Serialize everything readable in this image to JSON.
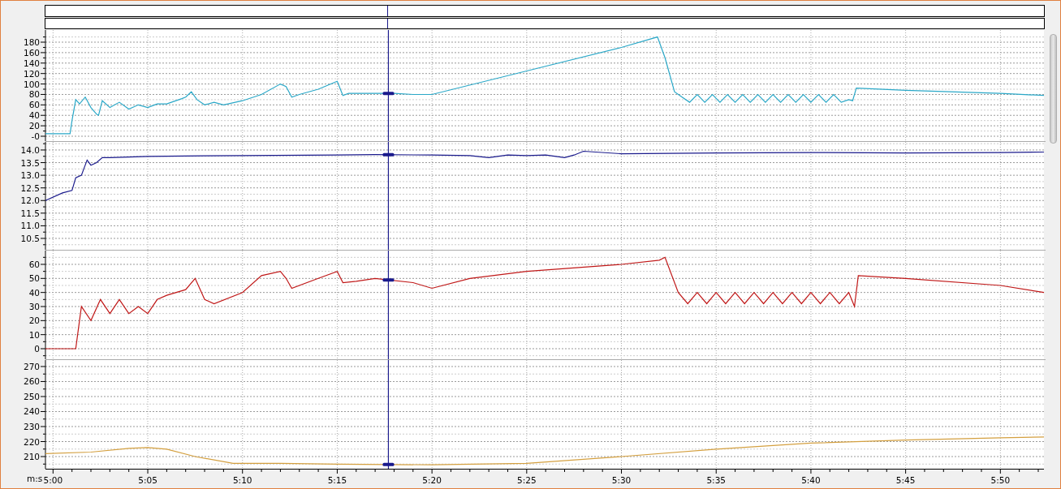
{
  "charts": [
    {
      "chart_data": {
        "type": "line",
        "xlim": [
          299.6,
          352.3
        ],
        "ylim": [
          -9.3,
          203.3
        ],
        "yticks": [
          {
            "value": 0,
            "label": "-0"
          },
          20,
          40,
          60,
          80,
          100,
          120,
          140,
          160,
          180
        ],
        "x": [
          299.6,
          300.4,
          300.9,
          301.0,
          301.2,
          301.4,
          301.7,
          302.0,
          302.3,
          302.4,
          302.6,
          303.0,
          303.5,
          304.0,
          304.5,
          305.0,
          305.5,
          306.0,
          306.8,
          307.0,
          307.3,
          307.6,
          308.0,
          308.5,
          309.0,
          310,
          311,
          312.0,
          312.3,
          312.6,
          313,
          314,
          315.0,
          315.3,
          315.6,
          316,
          317,
          318,
          319,
          320,
          325,
          330,
          331.9,
          332.3,
          332.8,
          333.2,
          333.6,
          334,
          334.4,
          334.8,
          335.2,
          335.6,
          336,
          336.4,
          336.8,
          337.2,
          337.6,
          338,
          338.4,
          338.8,
          339.2,
          339.6,
          340,
          340.4,
          340.8,
          341.2,
          341.6,
          342.0,
          342.2,
          342.4,
          345,
          350,
          352.3
        ],
        "series": [
          {
            "color": "#2aa8c8",
            "values": [
              5,
              5,
              5,
              30,
              70,
              62,
              75,
              55,
              42,
              40,
              68,
              55,
              65,
              52,
              60,
              55,
              62,
              62,
              72,
              75,
              85,
              70,
              60,
              65,
              60,
              68,
              80,
              100,
              95,
              75,
              80,
              90,
              105,
              78,
              82,
              82,
              82,
              82,
              80,
              80,
              125,
              170,
              190,
              150,
              85,
              75,
              65,
              80,
              65,
              80,
              65,
              80,
              65,
              80,
              65,
              80,
              65,
              80,
              65,
              80,
              65,
              80,
              65,
              80,
              65,
              80,
              65,
              70,
              68,
              92,
              88,
              82,
              78
            ]
          }
        ],
        "grid": true,
        "ref_lines": [
          {
            "axis": "x",
            "value": 317.7
          }
        ]
      }
    },
    {
      "chart_data": {
        "type": "line",
        "xlim": [
          299.6,
          352.3
        ],
        "ylim": [
          10.05,
          14.32
        ],
        "yticks": [
          {
            "value": 10.5,
            "label": "10.5"
          },
          {
            "value": 11,
            "label": "11.0"
          },
          {
            "value": 11.5,
            "label": "11.5"
          },
          {
            "value": 12,
            "label": "12.0"
          },
          {
            "value": 12.5,
            "label": "12.5"
          },
          {
            "value": 13,
            "label": "13.0"
          },
          {
            "value": 13.5,
            "label": "13.5"
          },
          {
            "value": 14,
            "label": "14.0"
          }
        ],
        "x": [
          299.6,
          300.5,
          301.0,
          301.2,
          301.5,
          301.8,
          302.0,
          302.3,
          302.6,
          303,
          305,
          308,
          310,
          315,
          317,
          320,
          322,
          323,
          324,
          325,
          326,
          327,
          327.5,
          328,
          330,
          335,
          340,
          345,
          350,
          352.3
        ],
        "series": [
          {
            "color": "#1a1a8c",
            "values": [
              12.0,
              12.3,
              12.4,
              12.9,
              13.0,
              13.6,
              13.4,
              13.5,
              13.7,
              13.7,
              13.75,
              13.77,
              13.78,
              13.8,
              13.82,
              13.8,
              13.78,
              13.7,
              13.8,
              13.78,
              13.8,
              13.7,
              13.8,
              13.95,
              13.85,
              13.88,
              13.9,
              13.88,
              13.9,
              13.92
            ]
          }
        ],
        "grid": true,
        "ref_lines": [
          {
            "axis": "x",
            "value": 317.7
          }
        ]
      }
    },
    {
      "chart_data": {
        "type": "line",
        "xlim": [
          299.6,
          352.3
        ],
        "ylim": [
          -7.5,
          69.8
        ],
        "yticks": [
          0,
          10,
          20,
          30,
          40,
          50,
          60
        ],
        "x": [
          299.6,
          301.2,
          301.5,
          302.0,
          302.5,
          303.0,
          303.5,
          304.0,
          304.5,
          305.0,
          305.5,
          306.0,
          307.0,
          307.5,
          308.0,
          308.5,
          310,
          311,
          312,
          312.3,
          312.6,
          314,
          315,
          315.3,
          316,
          317,
          319,
          320,
          322,
          325,
          330,
          332,
          332.3,
          333,
          333.5,
          334,
          334.5,
          335,
          335.5,
          336,
          336.5,
          337,
          337.5,
          338,
          338.5,
          339,
          339.5,
          340,
          340.5,
          341,
          341.5,
          342,
          342.3,
          342.5,
          345,
          350,
          352.3
        ],
        "series": [
          {
            "color": "#c01818",
            "values": [
              0,
              0,
              30,
              20,
              35,
              25,
              35,
              25,
              30,
              25,
              35,
              38,
              42,
              50,
              35,
              32,
              40,
              52,
              55,
              50,
              43,
              50,
              55,
              47,
              48,
              50,
              47,
              43,
              50,
              55,
              60,
              63,
              65,
              40,
              32,
              40,
              32,
              40,
              32,
              40,
              32,
              40,
              32,
              40,
              32,
              40,
              32,
              40,
              32,
              40,
              32,
              40,
              30,
              52,
              50,
              45,
              40
            ]
          }
        ],
        "grid": true,
        "ref_lines": [
          {
            "axis": "x",
            "value": 317.7
          }
        ]
      }
    },
    {
      "chart_data": {
        "type": "line",
        "xlabel": "m:s",
        "xlim": [
          299.6,
          352.3
        ],
        "ylim": [
          201.9,
          274.3
        ],
        "yticks": [
          210,
          220,
          230,
          240,
          250,
          260,
          270
        ],
        "xticks": [
          {
            "value": 300,
            "label": "5:00"
          },
          {
            "value": 305,
            "label": "5:05"
          },
          {
            "value": 310,
            "label": "5:10"
          },
          {
            "value": 315,
            "label": "5:15"
          },
          {
            "value": 320,
            "label": "5:20"
          },
          {
            "value": 325,
            "label": "5:25"
          },
          {
            "value": 330,
            "label": "5:30"
          },
          {
            "value": 335,
            "label": "5:35"
          },
          {
            "value": 340,
            "label": "5:40"
          },
          {
            "value": 345,
            "label": "5:45"
          },
          {
            "value": 350,
            "label": "5:50"
          }
        ],
        "x": [
          299.6,
          302,
          304,
          305,
          306,
          307.5,
          309.5,
          312,
          315,
          320,
          325,
          330,
          335,
          340,
          345,
          350,
          352.3
        ],
        "series": [
          {
            "color": "#d4a040",
            "values": [
              212,
              213,
              215.5,
              216,
              215,
              210,
              205.5,
              205.5,
              205,
              204.5,
              205.5,
              210,
              215,
              219,
              221,
              222.5,
              223
            ]
          }
        ],
        "grid": true,
        "ref_lines": [
          {
            "axis": "x",
            "value": 317.7
          }
        ]
      }
    }
  ]
}
